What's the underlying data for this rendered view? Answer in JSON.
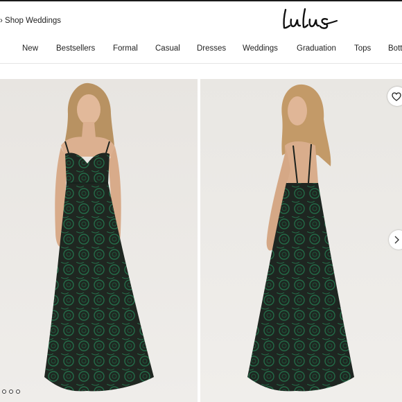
{
  "header": {
    "promo_text": "› Shop Weddings",
    "logo_text": "lulus"
  },
  "nav": {
    "items": [
      {
        "label": "New"
      },
      {
        "label": "Bestsellers"
      },
      {
        "label": "Formal"
      },
      {
        "label": "Casual"
      },
      {
        "label": "Dresses"
      },
      {
        "label": "Weddings"
      },
      {
        "label": "Graduation"
      },
      {
        "label": "Tops"
      },
      {
        "label": "Bott"
      }
    ]
  },
  "gallery": {
    "image_count": 3,
    "active_index": 0,
    "colors": {
      "dress_dark": "#1e2a22",
      "dress_green": "#1f6b45",
      "backdrop_left": "#ebe8e4",
      "backdrop_right": "#eceae6"
    }
  },
  "icons": {
    "favorite": "heart-icon",
    "next": "chevron-right-icon"
  }
}
